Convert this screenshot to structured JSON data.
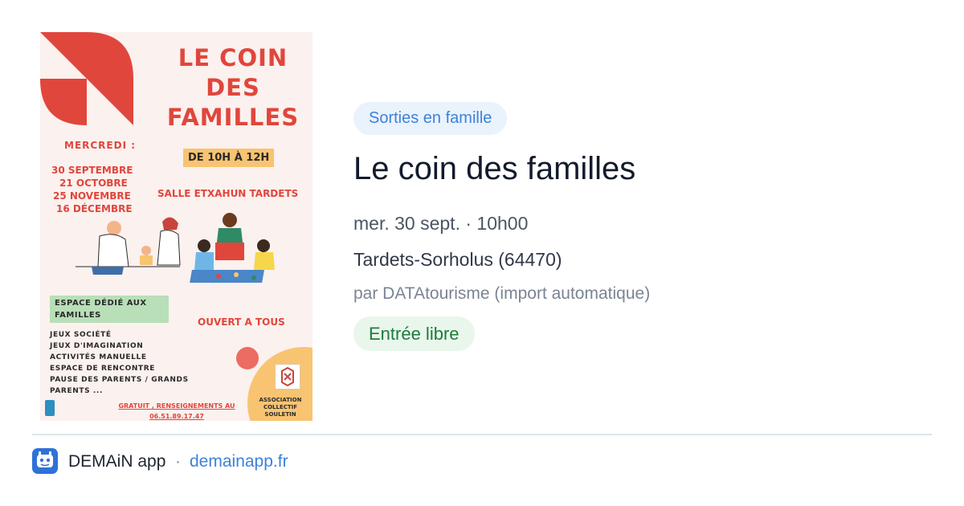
{
  "poster": {
    "title_lines": [
      "LE COIN",
      "DES",
      "FAMILLES"
    ],
    "day_label": "MERCREDI :",
    "dates": [
      "30 SEPTEMBRE",
      "21 OCTOBRE",
      "25 NOVEMBRE",
      "16 DÉCEMBRE"
    ],
    "hours": "DE 10H À 12H",
    "venue": "SALLE ETXAHUN TARDETS",
    "space_lines": [
      "ESPACE DÉDIÉ AUX",
      "FAMILLES"
    ],
    "open_text": "OUVERT A TOUS",
    "activities": [
      "JEUX SOCIÉTÉ",
      "JEUX D'IMAGINATION",
      "ACTIVITÉS MANUELLE",
      "ESPACE DE RENCONTRE",
      "PAUSE DES PARENTS / GRANDS",
      "PARENTS ..."
    ],
    "info_lines": [
      "GRATUIT , RENSEIGNEMENTS AU",
      "06.51.89.17.47"
    ],
    "association_lines": [
      "ASSOCIATION",
      "COLLECTIF",
      "SOULETIN"
    ],
    "accent_color": "#e1463c",
    "yellow_color": "#f8c472"
  },
  "event": {
    "category": "Sorties en famille",
    "title": "Le coin des familles",
    "datetime": "mer. 30 sept. · 10h00",
    "location": "Tardets-Sorholus (64470)",
    "organizer": "par DATAtourisme (import automatique)",
    "price_badge": "Entrée libre"
  },
  "footer": {
    "app_icon": "demain-app-icon",
    "app_name": "DEMAiN app",
    "separator": "·",
    "url": "demainapp.fr"
  },
  "colors": {
    "link_blue": "#3d82d8",
    "title_dark": "#121a2c",
    "badge_green": "#1e7a3c"
  }
}
